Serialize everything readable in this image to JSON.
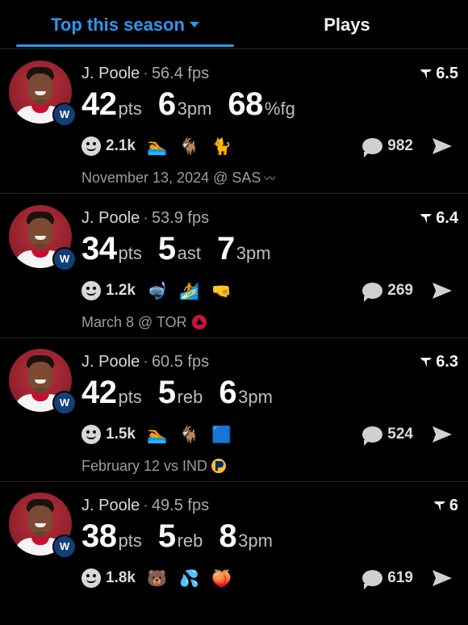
{
  "tabs": {
    "top_season": "Top this season",
    "plays": "Plays"
  },
  "accent_color": "#2f96ee",
  "separator": "·",
  "cards": [
    {
      "player": "J. Poole",
      "fps": "56.4 fps",
      "rating": "6.5",
      "stats": [
        {
          "num": "42",
          "unit": "pts"
        },
        {
          "num": "6",
          "unit": "3pm"
        },
        {
          "num": "68",
          "unit": "%fg"
        }
      ],
      "reaction_count": "2.1k",
      "emojis": [
        "🏊",
        "🐐",
        "🐈"
      ],
      "comments": "982",
      "date": "November 13, 2024 @ SAS",
      "opponent_logo": "spurs-logo"
    },
    {
      "player": "J. Poole",
      "fps": "53.9 fps",
      "rating": "6.4",
      "stats": [
        {
          "num": "34",
          "unit": "pts"
        },
        {
          "num": "5",
          "unit": "ast"
        },
        {
          "num": "7",
          "unit": "3pm"
        }
      ],
      "reaction_count": "1.2k",
      "emojis": [
        "🤿",
        "🏄",
        "🤜"
      ],
      "comments": "269",
      "date": "March 8 @ TOR",
      "opponent_logo": "raptors-logo"
    },
    {
      "player": "J. Poole",
      "fps": "60.5 fps",
      "rating": "6.3",
      "stats": [
        {
          "num": "42",
          "unit": "pts"
        },
        {
          "num": "5",
          "unit": "reb"
        },
        {
          "num": "6",
          "unit": "3pm"
        }
      ],
      "reaction_count": "1.5k",
      "emojis": [
        "🏊",
        "🐐",
        "🟦"
      ],
      "comments": "524",
      "date": "February 12 vs IND",
      "opponent_logo": "pacers-logo"
    },
    {
      "player": "J. Poole",
      "fps": "49.5 fps",
      "rating": "6",
      "stats": [
        {
          "num": "38",
          "unit": "pts"
        },
        {
          "num": "5",
          "unit": "reb"
        },
        {
          "num": "8",
          "unit": "3pm"
        }
      ],
      "reaction_count": "1.8k",
      "emojis": [
        "🐻",
        "💦",
        "🍑"
      ],
      "comments": "619",
      "date": "",
      "opponent_logo": ""
    }
  ]
}
